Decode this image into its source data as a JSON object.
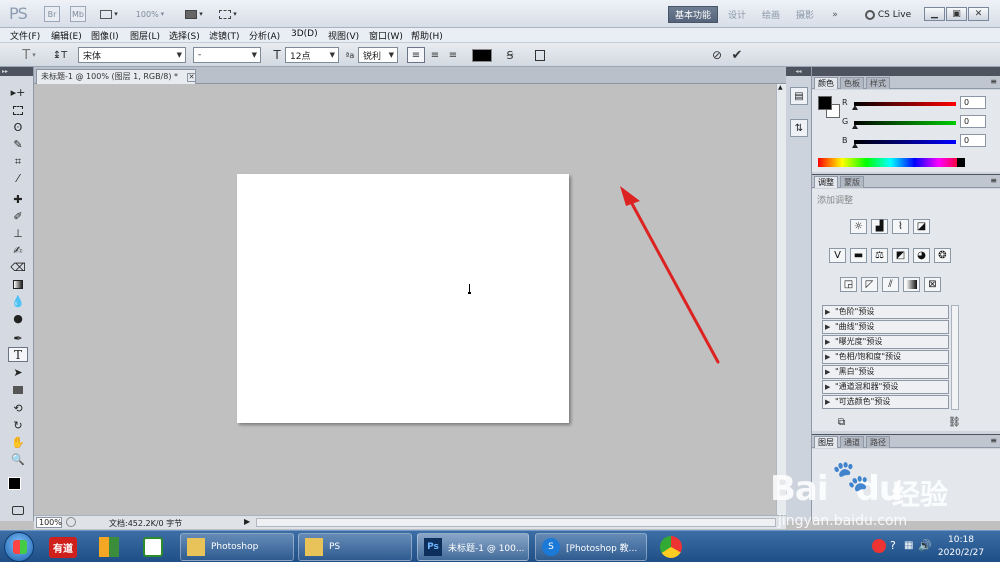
{
  "appbar": {
    "logo": "PS",
    "br": "Br",
    "mb": "Mb",
    "zoom": "100%",
    "workspaces": [
      "基本功能",
      "设计",
      "绘画",
      "摄影"
    ],
    "more": "»",
    "cslive": "CS Live"
  },
  "menu": [
    "文件(F)",
    "编辑(E)",
    "图像(I)",
    "图层(L)",
    "选择(S)",
    "滤镜(T)",
    "分析(A)",
    "3D(D)",
    "视图(V)",
    "窗口(W)",
    "帮助(H)"
  ],
  "options": {
    "font_family": "宋体",
    "font_style": "-",
    "font_size": "12点",
    "antialias_prefix": "ªa",
    "antialias": "锐利"
  },
  "document": {
    "tab_title": "未标题-1 @ 100% (图层 1, RGB/8) *",
    "zoom": "100%",
    "doc_info": "文档:452.2K/0 字节"
  },
  "color_panel": {
    "tabs": [
      "颜色",
      "色板",
      "样式"
    ],
    "r_label": "R",
    "g_label": "G",
    "b_label": "B",
    "r": "0",
    "g": "0",
    "b": "0"
  },
  "adjust_panel": {
    "tabs": [
      "调整",
      "蒙版"
    ],
    "title": "添加调整",
    "presets": [
      "\"色阶\"预设",
      "\"曲线\"预设",
      "\"曝光度\"预设",
      "\"色相/饱和度\"预设",
      "\"黑白\"预设",
      "\"通道混和器\"预设",
      "\"可选颜色\"预设"
    ]
  },
  "layers_panel": {
    "tabs": [
      "图层",
      "通道",
      "路径"
    ]
  },
  "watermark": {
    "brand": "Bai",
    "brand2": "du",
    "cn": "经验",
    "url": "jingyan.baidu.com"
  },
  "taskbar": {
    "pin_youdao": "有道",
    "tasks": [
      "Photoshop",
      "PS",
      "未标题-1 @ 100...",
      "[Photoshop 教..."
    ],
    "time": "10:18",
    "date": "2020/2/27"
  },
  "colors": {
    "accent_red": "#dd2222",
    "workspace_active": "#5f6e83",
    "taskbar": "#2a5b93"
  }
}
